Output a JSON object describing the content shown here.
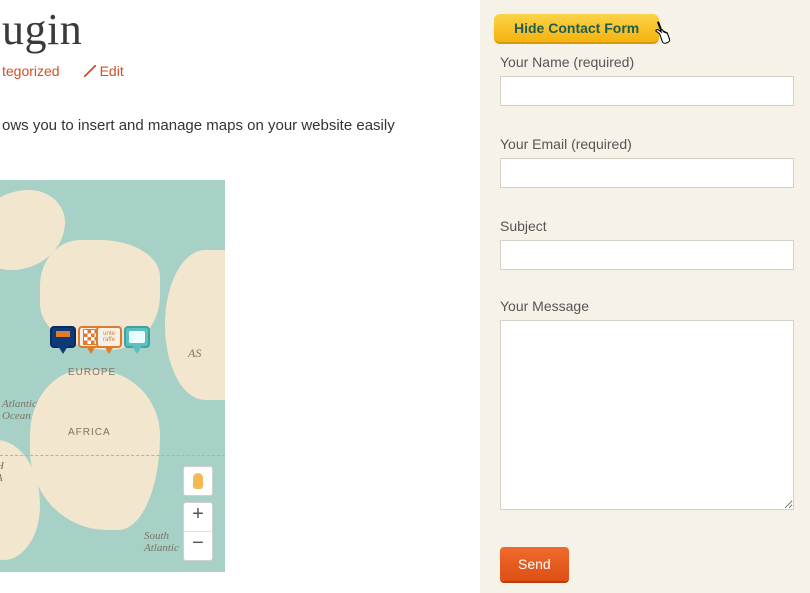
{
  "page": {
    "title_visible": "ugin"
  },
  "meta": {
    "category_label": "tegorized",
    "edit_label": "Edit"
  },
  "tagline_visible": "ows you to insert and manage maps on your website easily",
  "map": {
    "labels": {
      "europe": "EUROPE",
      "africa": "AFRICA",
      "asia_abbrev": "AS",
      "north_atlantic": "Atlantic\nOcean",
      "south_atlantic": "South\nAtlantic",
      "north_america": "H\nA"
    },
    "controls": {
      "pegman": "pegman",
      "zoom_in": "+",
      "zoom_out": "−"
    }
  },
  "sidebar": {
    "hide_button": "Hide Contact Form",
    "fields": {
      "name_label": "Your Name (required)",
      "email_label": "Your Email (required)",
      "subject_label": "Subject",
      "message_label": "Your Message"
    },
    "send_label": "Send"
  }
}
